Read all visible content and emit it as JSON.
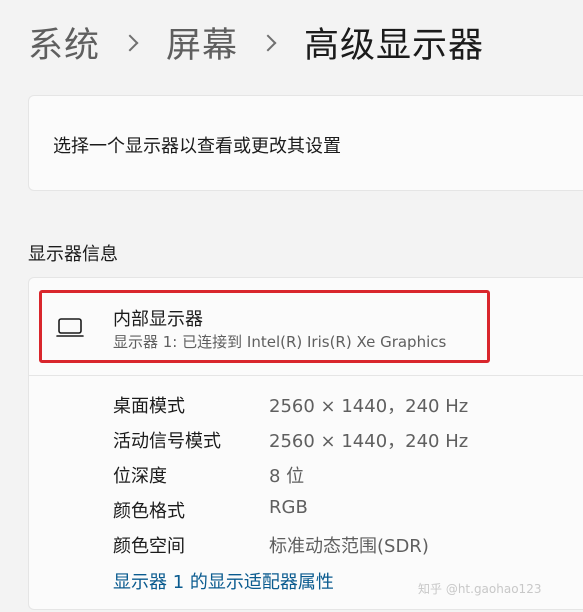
{
  "breadcrumb": {
    "items": [
      "系统",
      "屏幕",
      "高级显示器"
    ]
  },
  "select_card": {
    "text": "选择一个显示器以查看或更改其设置"
  },
  "section": {
    "title": "显示器信息"
  },
  "monitor": {
    "name": "内部显示器",
    "subtitle": "显示器 1: 已连接到 Intel(R) Iris(R) Xe Graphics",
    "icon": "laptop-monitor-icon"
  },
  "details": [
    {
      "label": "桌面模式",
      "value": "2560 × 1440，240 Hz"
    },
    {
      "label": "活动信号模式",
      "value": "2560 × 1440，240 Hz"
    },
    {
      "label": "位深度",
      "value": "8 位"
    },
    {
      "label": "颜色格式",
      "value": "RGB"
    },
    {
      "label": "颜色空间",
      "value": "标准动态范围(SDR)"
    }
  ],
  "adapter_link": "显示器 1 的显示适配器属性",
  "watermark": "知乎 @ht.gaohao123",
  "colors": {
    "background": "#f3f3f3",
    "card": "#fbfbfb",
    "highlight_border": "#d9262c",
    "link": "#0a5b8f"
  }
}
